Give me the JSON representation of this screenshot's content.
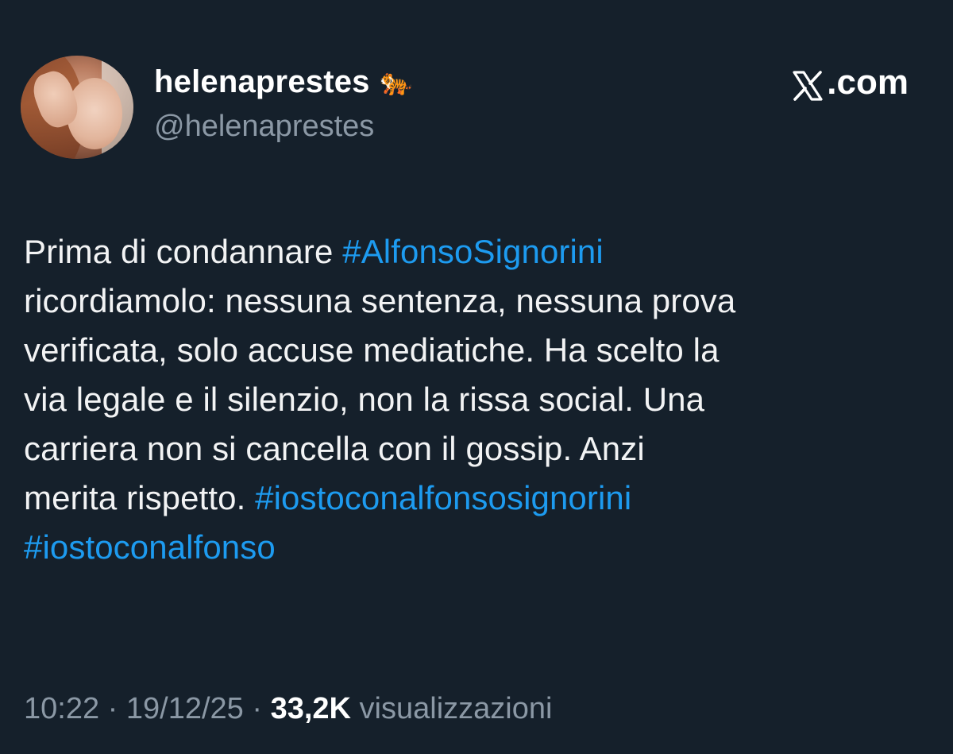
{
  "author": {
    "display_name": "helenaprestes",
    "badge_emoji": "🐅",
    "handle": "@helenaprestes"
  },
  "brand": {
    "label": ".com"
  },
  "tweet": {
    "lines": [
      [
        {
          "text": "Prima di condannare ",
          "hashtag": false
        },
        {
          "text": "#AlfonsoSignorini",
          "hashtag": true
        }
      ],
      [
        {
          "text": "ricordiamolo: nessuna sentenza, nessuna prova",
          "hashtag": false
        }
      ],
      [
        {
          "text": "verificata, solo accuse mediatiche. Ha scelto la",
          "hashtag": false
        }
      ],
      [
        {
          "text": "via legale e il silenzio, non la rissa social. Una",
          "hashtag": false
        }
      ],
      [
        {
          "text": "carriera non si cancella con il gossip. Anzi",
          "hashtag": false
        }
      ],
      [
        {
          "text": "merita rispetto. ",
          "hashtag": false
        },
        {
          "text": "#iostoconalfonsosignorini",
          "hashtag": true
        }
      ],
      [
        {
          "text": "#iostoconalfonso",
          "hashtag": true
        }
      ]
    ]
  },
  "meta": {
    "time": "10:22",
    "separator": " · ",
    "date": "19/12/25",
    "views_count": "33,2K",
    "views_label": " visualizzazioni"
  },
  "colors": {
    "background": "#15202b",
    "hashtag": "#1d9bf0",
    "secondary_text": "#8b98a5",
    "primary_text": "#ffffff"
  }
}
